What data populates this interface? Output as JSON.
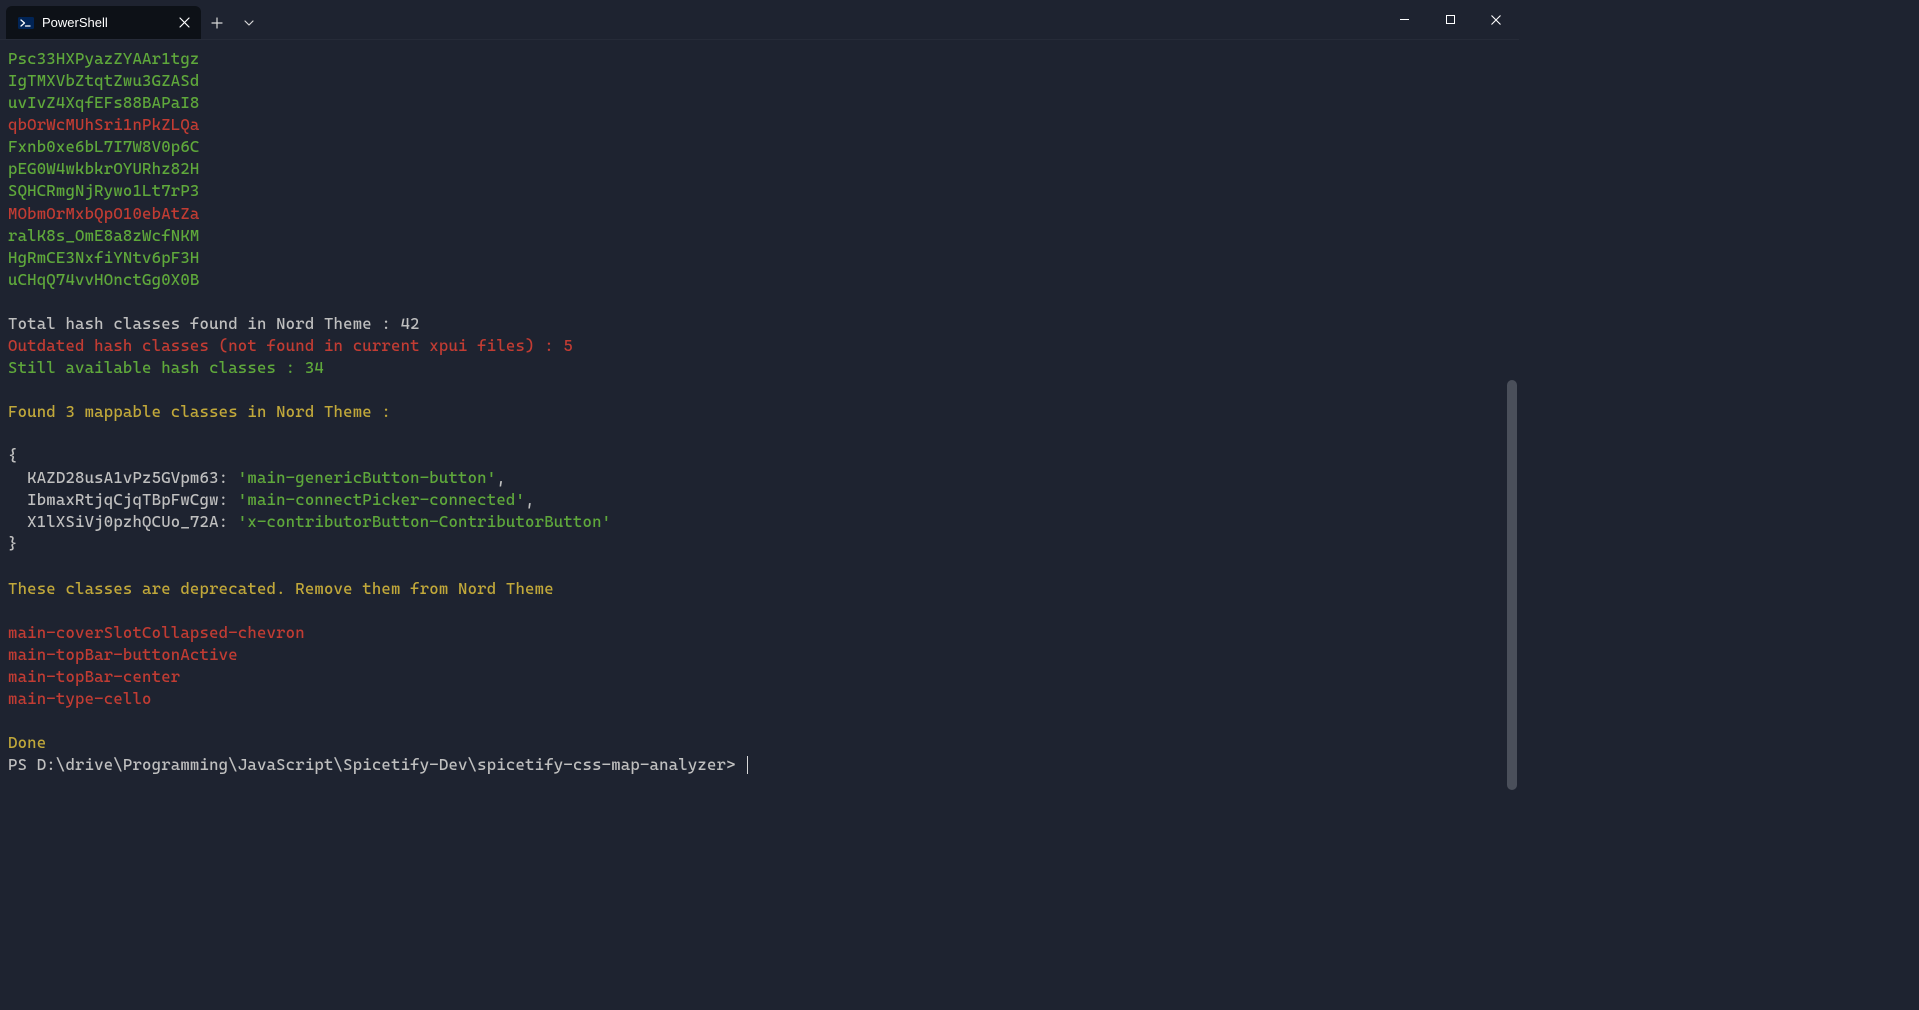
{
  "titlebar": {
    "tab_title": "PowerShell"
  },
  "hash_lines": [
    {
      "text": "Psc33HXPyazZYAAr1tgz",
      "color": "green"
    },
    {
      "text": "IgTMXVbZtqtZwu3GZASd",
      "color": "green"
    },
    {
      "text": "uvIvZ4XqfEFs88BAPaI8",
      "color": "green"
    },
    {
      "text": "qbOrWcMUhSri1nPkZLQa",
      "color": "red"
    },
    {
      "text": "Fxnb0xe6bL7I7W8V0p6C",
      "color": "green"
    },
    {
      "text": "pEG0W4wkbkrOYURhz82H",
      "color": "green"
    },
    {
      "text": "SQHCRmgNjRywo1Lt7rP3",
      "color": "green"
    },
    {
      "text": "MObmOrMxbQpO10ebAtZa",
      "color": "red"
    },
    {
      "text": "ralK8s_OmE8a8zWcfNKM",
      "color": "green"
    },
    {
      "text": "HgRmCE3NxfiYNtv6pF3H",
      "color": "green"
    },
    {
      "text": "uCHqQ74vvHOnctGg0X0B",
      "color": "green"
    }
  ],
  "summary": {
    "total": "Total hash classes found in Nord Theme : 42",
    "outdated": "Outdated hash classes (not found in current xpui files) : 5",
    "still": "Still available hash classes : 34"
  },
  "mappable": {
    "header": "Found 3 mappable classes in Nord Theme :",
    "open": "{",
    "rows": [
      {
        "key": "  KAZD28usA1vPz5GVpm63:",
        "val": " 'main-genericButton-button'",
        "trail": ","
      },
      {
        "key": "  IbmaxRtjqCjqTBpFwCgw:",
        "val": " 'main-connectPicker-connected'",
        "trail": ","
      },
      {
        "key": "  X1lXSiVj0pzhQCUo_72A:",
        "val": " 'x-contributorButton-ContributorButton'",
        "trail": ""
      }
    ],
    "close": "}"
  },
  "deprecated": {
    "header": "These classes are deprecated. Remove them from Nord Theme",
    "items": [
      "main-coverSlotCollapsed-chevron",
      "main-topBar-buttonActive",
      "main-topBar-center",
      "main-type-cello"
    ]
  },
  "done": "Done",
  "prompt": "PS D:\\drive\\Programming\\JavaScript\\Spicetify-Dev\\spicetify-css-map-analyzer> "
}
